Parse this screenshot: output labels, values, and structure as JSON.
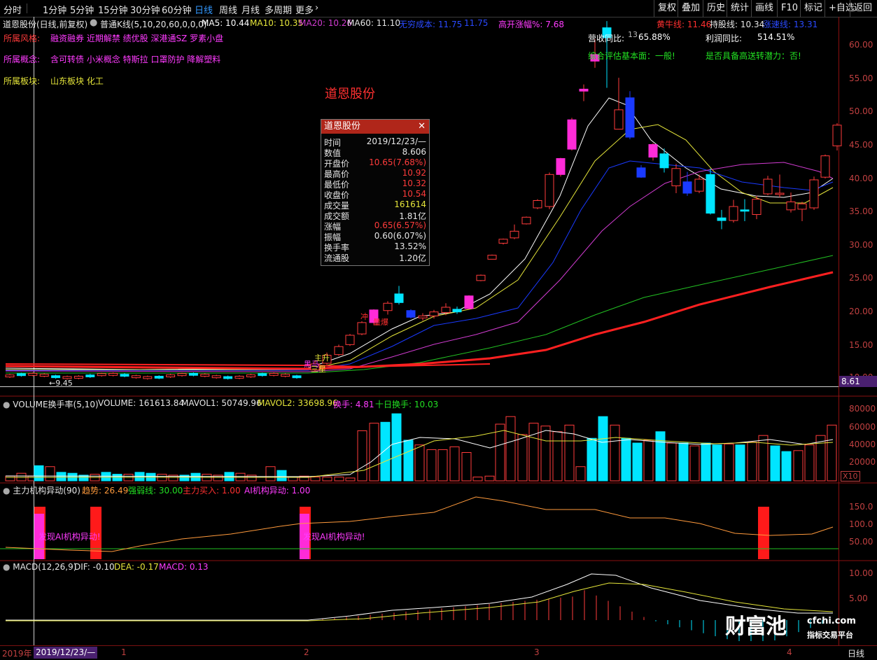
{
  "topbar": {
    "periods": [
      "分时",
      "1分钟",
      "5分钟",
      "15分钟",
      "30分钟",
      "60分钟",
      "日线",
      "周线",
      "月线",
      "多周期",
      "更多"
    ],
    "active_period": "日线",
    "right_buttons": [
      "复权",
      "叠加",
      "历史",
      "统计",
      "画线",
      "F10",
      "标记",
      "+自选",
      "返回"
    ]
  },
  "header": {
    "stock_title": "道恩股份(日线,前复权)",
    "kline_type": "普通K线(5,10,20,60,0,0,0)",
    "ma5": "MA5: 10.44",
    "ma10": "MA10: 10.35",
    "ma20": "MA20: 10.26",
    "ma60": "MA60: 11.10",
    "cost": "无穷成本: 11.75",
    "cost2": "11.75",
    "gap": "高开涨幅%: 7.68",
    "bull": "黄牛线: 11.46",
    "hold": "持股线: 10.34",
    "trend": "涨速线: 13.31"
  },
  "info": {
    "style_label": "所属风格:",
    "style_value": "融资融券 近期解禁 绩优股 深港通SZ 罗素小盘",
    "concept_label": "所属概念:",
    "concept_value": "含可转债 小米概念 特斯拉 口罩防护 降解塑料",
    "sector_label": "所属板块:",
    "sector_value": "山东板块  化工",
    "rev_label": "营收同比:",
    "rev_value": "65.88%",
    "profit_label": "利润同比:",
    "profit_value": "514.51%",
    "fund_eval": "综合评估基本面：一般!",
    "bonus_eval": "是否具备高送转潜力：否!",
    "stock_name": "道恩股份",
    "low_mark": "←9.45",
    "hl_extra": "13",
    "sig1": "主升",
    "sig2": "黑马",
    "sig3": "三星",
    "sig4": "量爆",
    "sig5": "冲"
  },
  "tooltip": {
    "title": "道恩股份",
    "rows": [
      {
        "label": "时间",
        "value": "2019/12/23/—",
        "color": "#e6e6e6"
      },
      {
        "label": "数值",
        "value": "8.606",
        "color": "#e6e6e6"
      },
      {
        "label": "开盘价",
        "value": "10.65(7.68%)",
        "color": "#ff3b3b"
      },
      {
        "label": "最高价",
        "value": "10.92",
        "color": "#ff3b3b"
      },
      {
        "label": "最低价",
        "value": "10.32",
        "color": "#ff3b3b"
      },
      {
        "label": "收盘价",
        "value": "10.54",
        "color": "#ff3b3b"
      },
      {
        "label": "成交量",
        "value": "161614",
        "color": "#e5e53a"
      },
      {
        "label": "成交额",
        "value": "1.81亿",
        "color": "#e6e6e6"
      },
      {
        "label": "涨幅",
        "value": "0.65(6.57%)",
        "color": "#ff3b3b"
      },
      {
        "label": "振幅",
        "value": "0.60(6.07%)",
        "color": "#e6e6e6"
      },
      {
        "label": "换手率",
        "value": "13.52%",
        "color": "#e6e6e6"
      },
      {
        "label": "流通股",
        "value": "1.20亿",
        "color": "#e6e6e6"
      }
    ]
  },
  "price_axis": {
    "ticks": [
      "60.00",
      "55.00",
      "50.00",
      "45.00",
      "40.00",
      "35.00",
      "30.00",
      "25.00",
      "20.00",
      "15.00",
      "10.00"
    ],
    "cursor_value": "8.61"
  },
  "volume_panel": {
    "title": "VOLUME换手率(5,10)",
    "volume": "VOLUME: 161613.84",
    "mavol1": "MAVOL1: 50749.96",
    "mavol2": "MAVOL2: 33698.96",
    "turnover": "换手: 4.81",
    "turnover10": "十日换手: 10.03",
    "ticks": [
      "80000",
      "60000",
      "40000",
      "20000"
    ],
    "unit": "X10"
  },
  "inst_panel": {
    "title": "主力机构异动(90)",
    "trend": "趋势: 26.49",
    "weak": "强弱线: 30.00",
    "buy": "主力买入: 1.00",
    "ai": "AI机构异动: 1.00",
    "alert": "发现AI机构异动!",
    "ticks": [
      "150.0",
      "100.0",
      "50.00"
    ]
  },
  "macd_panel": {
    "title": "MACD(12,26,9)",
    "dif": "DIF: -0.10",
    "dea": "DEA: -0.17",
    "macd": "MACD: 0.13",
    "ticks": [
      "10.00",
      "5.00"
    ]
  },
  "bottombar": {
    "year": "2019年",
    "date": "2019/12/23/—",
    "months": [
      "1",
      "2",
      "3",
      "4"
    ],
    "period": "日线"
  },
  "watermark": {
    "brand": "财富池",
    "site": "cfchi.com",
    "slogan": "指标交易平台"
  },
  "colors": {
    "up": "#ff3b3b",
    "down": "#00e5ff",
    "ma5": "#ffffff",
    "ma10": "#e5e53a",
    "ma20": "#1a3aff",
    "ma60": "#d23cd2",
    "ma120": "#22c022",
    "ma250": "#ff2020"
  }
}
